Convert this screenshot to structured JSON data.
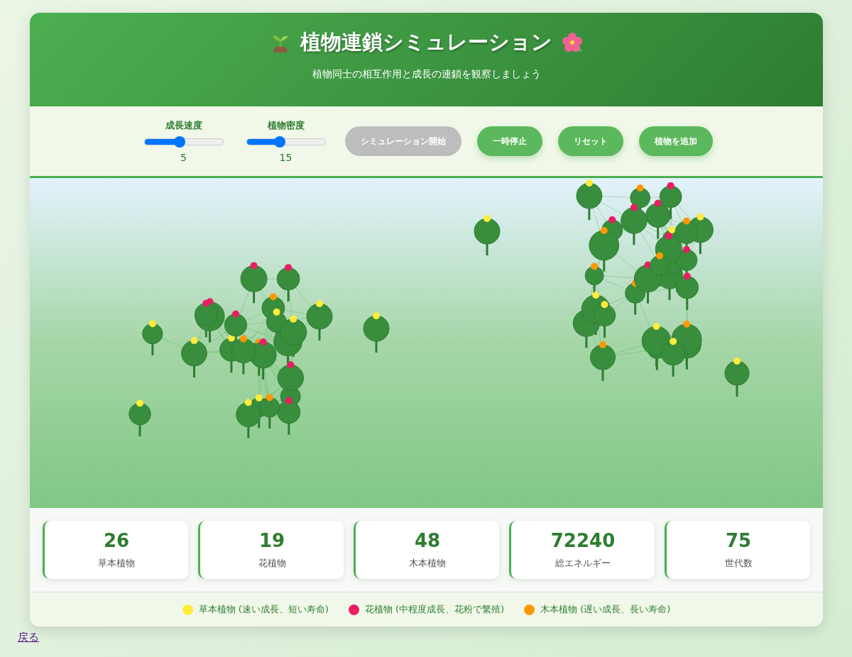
{
  "header": {
    "title": "植物連鎖シミュレーション",
    "subtitle": "植物同士の相互作用と成長の連鎖を観察しましょう"
  },
  "sliders": [
    {
      "label": "成長速度",
      "level": 0.45,
      "reading": "5"
    },
    {
      "label": "植物密度",
      "level": 0.42,
      "reading": "15"
    }
  ],
  "buttons": [
    {
      "label": "シミュレーション開始",
      "disabled": true
    },
    {
      "label": "一時停止",
      "disabled": false
    },
    {
      "label": "リセット",
      "disabled": false
    },
    {
      "label": "植物を追加",
      "disabled": false
    }
  ],
  "stats": [
    {
      "value": "26",
      "label": "草本植物"
    },
    {
      "value": "19",
      "label": "花植物"
    },
    {
      "value": "48",
      "label": "木本植物"
    },
    {
      "value": "72240",
      "label": "総エネルギー"
    },
    {
      "value": "75",
      "label": "世代数"
    }
  ],
  "legend": [
    {
      "label": "草本植物 (速い成長、短い寿命)",
      "color": "#ffeb3b"
    },
    {
      "label": "花植物 (中程度成長、花粉で繁殖)",
      "color": "#e91e63"
    },
    {
      "label": "木本植物 (遅い成長、長い寿命)",
      "color": "#ff9800"
    }
  ],
  "back_link": "戻る"
}
